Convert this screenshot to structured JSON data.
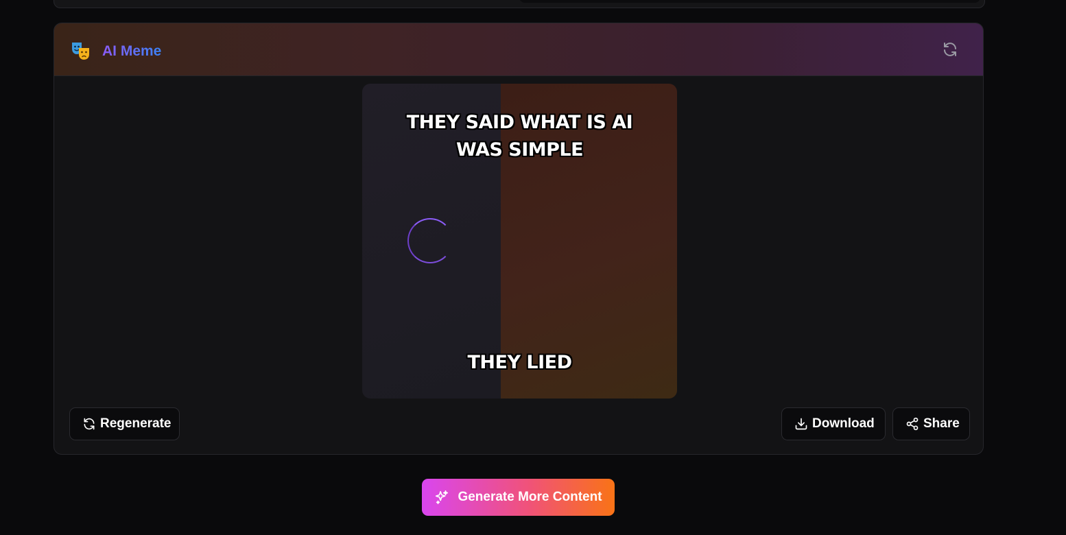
{
  "card": {
    "title": "AI Meme",
    "icon": "theater-masks-icon",
    "refresh_icon": "refresh-icon"
  },
  "meme": {
    "top_text": "THEY SAID WHAT IS AI WAS SIMPLE",
    "bottom_text": "THEY LIED"
  },
  "actions": {
    "regenerate_label": "Regenerate",
    "download_label": "Download",
    "share_label": "Share"
  },
  "footer": {
    "generate_more_label": "Generate More Content"
  },
  "colors": {
    "accent_purple": "#8b5cf6",
    "accent_blue": "#3b82f6",
    "gradient_pink": "#d946ef",
    "gradient_orange": "#f97316"
  }
}
